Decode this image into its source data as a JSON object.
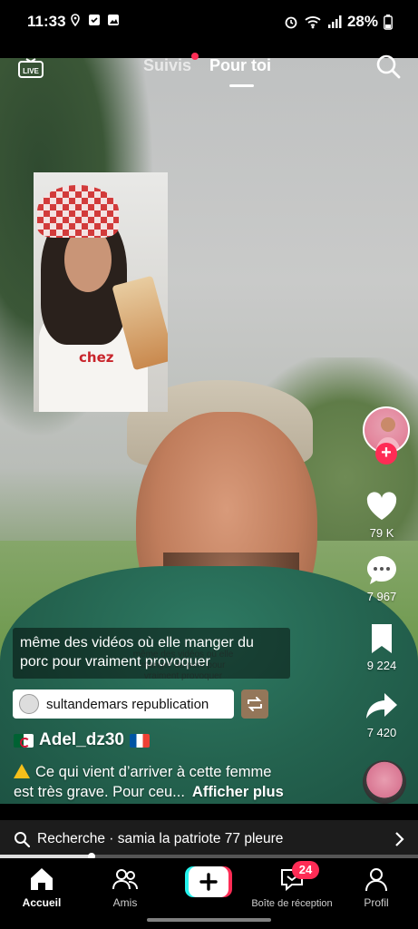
{
  "status_bar": {
    "time": "11:33",
    "battery": "28%",
    "icons": [
      "location-icon",
      "check-square-icon",
      "image-icon",
      "alarm-icon",
      "wifi-icon",
      "signal-icon",
      "battery-icon"
    ]
  },
  "top_nav": {
    "live_label": "LIVE",
    "tab_following": "Suivis",
    "tab_foryou": "Pour toi",
    "active_tab": "Pour toi"
  },
  "video": {
    "caption_line1": "même des vidéos où elle manger du",
    "caption_line2": "porc pour vraiment provoquer",
    "overlay_text_line1": "même des vidéos où elle",
    "overlay_text_line2": "manger du porc pour",
    "overlay_text_line3": "vraiment provoquer",
    "shirt_text": "chez"
  },
  "repost": {
    "label": "sultandemars republication"
  },
  "author": {
    "username": "Adel_dz30"
  },
  "description": {
    "text_line1": "Ce qui vient d’arriver à cette femme",
    "text_line2": "est très grave. Pour ceu...",
    "more": "Afficher plus"
  },
  "rail": {
    "likes": "79 K",
    "comments": "7 967",
    "saves": "9 224",
    "shares": "7 420"
  },
  "search_suggestion": {
    "prefix": "Recherche",
    "separator": " · ",
    "query": "samia la patriote 77 pleure"
  },
  "progress": {
    "fraction": 0.22
  },
  "bottom_nav": {
    "home": "Accueil",
    "friends": "Amis",
    "inbox": "Boîte de réception",
    "inbox_badge": "24",
    "profile": "Profil"
  },
  "colors": {
    "accent": "#fe2c55",
    "create_cyan": "#25f4ee",
    "warning": "#f6c01a"
  }
}
